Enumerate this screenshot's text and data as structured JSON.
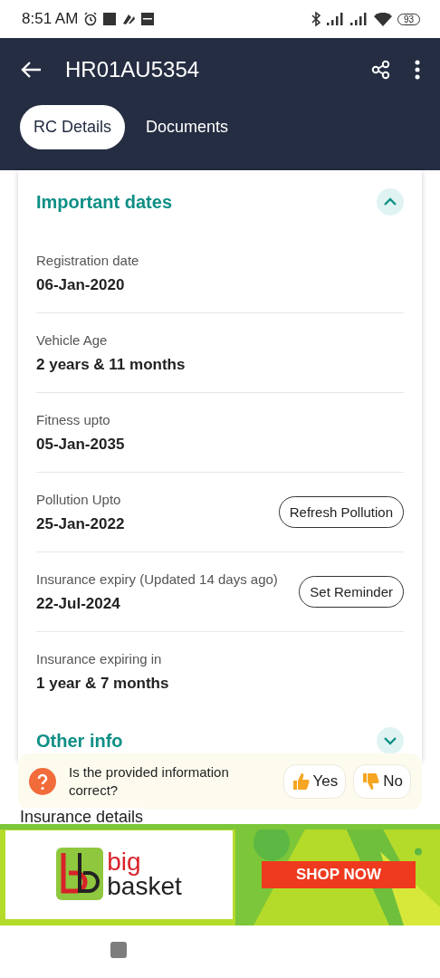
{
  "status_bar": {
    "time": "8:51 AM",
    "battery": "93"
  },
  "app_bar": {
    "title": "HR01AU5354"
  },
  "tabs": [
    {
      "label": "RC Details",
      "selected": true
    },
    {
      "label": "Documents",
      "selected": false
    }
  ],
  "sections": [
    {
      "title": "Important dates",
      "expanded": true,
      "fields": [
        {
          "label": "Registration date",
          "value": "06-Jan-2020"
        },
        {
          "label": "Vehicle Age",
          "value": "2 years & 11 months"
        },
        {
          "label": "Fitness upto",
          "value": "05-Jan-2035"
        },
        {
          "label": "Pollution Upto",
          "value": "25-Jan-2022",
          "action": "Refresh Pollution"
        },
        {
          "label": "Insurance expiry (Updated 14 days ago)",
          "value": "22-Jul-2024",
          "action": "Set Reminder"
        },
        {
          "label": "Insurance expiring in",
          "value": "1 year & 7 months"
        }
      ]
    },
    {
      "title": "Other info",
      "expanded": false
    }
  ],
  "feedback": {
    "question": "Is the provided information correct?",
    "buttons": [
      {
        "kind": "up",
        "label": "Yes"
      },
      {
        "kind": "down",
        "label": "No"
      }
    ]
  },
  "next_section": {
    "title": "Insurance details"
  },
  "ad": {
    "brand_top": "big",
    "brand_bottom": "basket",
    "cta": "SHOP NOW"
  }
}
